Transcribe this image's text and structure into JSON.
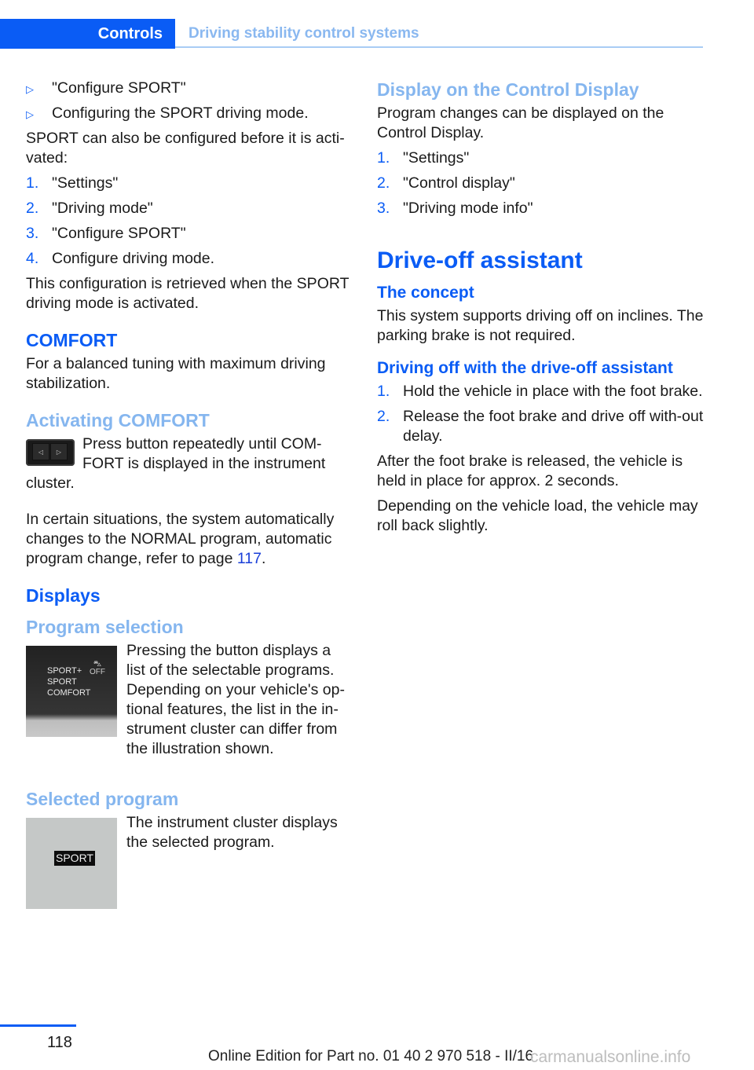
{
  "header": {
    "chapter": "Controls",
    "section": "Driving stability control systems"
  },
  "left": {
    "bullets": [
      "\"Configure SPORT\"",
      "Configuring the SPORT driving mode."
    ],
    "intro": "SPORT can also be configured before it is acti-vated:",
    "steps": [
      "\"Settings\"",
      "\"Driving mode\"",
      "\"Configure SPORT\"",
      "Configure driving mode."
    ],
    "steps_note": "This configuration is retrieved when the SPORT driving mode is activated.",
    "comfort": {
      "title": "COMFORT",
      "text": "For a balanced tuning with maximum driving stabilization."
    },
    "activating": {
      "title": "Activating COMFORT",
      "text": "Press button repeatedly until COM-FORT is displayed in the instrument cluster.",
      "button_glyphs": [
        "◁",
        "▷"
      ]
    },
    "auto_change": {
      "text": "In certain situations, the system automatically changes to the NORMAL program, automatic program change, refer to page ",
      "page_link": "117",
      "suffix": "."
    },
    "displays": {
      "title": "Displays"
    },
    "program_selection": {
      "title": "Program selection",
      "text": "Pressing the button displays a list of the selectable programs. Depending on your vehicle's op-tional features, the list in the in-strument cluster can differ from the illustration shown.",
      "figure_items": [
        "SPORT+",
        "SPORT",
        "COMFORT"
      ],
      "figure_badge": "OFF"
    },
    "selected_program": {
      "title": "Selected program",
      "text": "The instrument cluster displays the selected program.",
      "figure_label": "SPORT"
    }
  },
  "right": {
    "control_display": {
      "title": "Display on the Control Display",
      "text": "Program changes can be displayed on the Control Display.",
      "steps": [
        "\"Settings\"",
        "\"Control display\"",
        "\"Driving mode info\""
      ]
    },
    "drive_off": {
      "title": "Drive-off assistant",
      "concept_title": "The concept",
      "concept_text": "This system supports driving off on inclines. The parking brake is not required.",
      "driving_title": "Driving off with the drive-off assistant",
      "steps": [
        "Hold the vehicle in place with the foot brake.",
        "Release the foot brake and drive off with-out delay."
      ],
      "note1": "After the foot brake is released, the vehicle is held in place for approx. 2 seconds.",
      "note2": "Depending on the vehicle load, the vehicle may roll back slightly."
    }
  },
  "footer": {
    "page_number": "118",
    "edition": "Online Edition for Part no. 01 40 2 970 518 - II/16",
    "watermark": "carmanualsonline.info"
  },
  "colors": {
    "accent": "#0a5cf5",
    "accent_light": "#85b6ef"
  }
}
